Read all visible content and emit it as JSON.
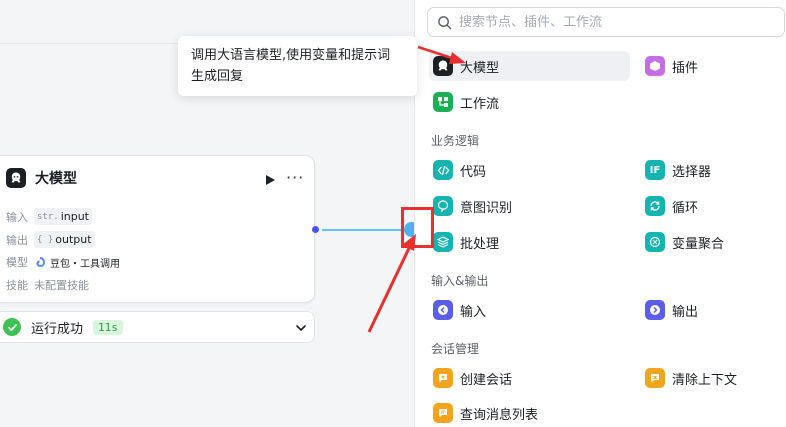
{
  "tooltip": {
    "line1": "调用大语言模型,使用变量和提示词",
    "line2": "生成回复"
  },
  "node": {
    "title": "大模型",
    "rows": {
      "input": {
        "label": "输入",
        "type": "str.",
        "value": "input"
      },
      "output": {
        "label": "输出",
        "type": "{ }",
        "value": "output"
      },
      "model": {
        "label": "模型",
        "value": "豆包・工具调用"
      },
      "skill": {
        "label": "技能",
        "value": "未配置技能"
      }
    }
  },
  "run_status": {
    "text": "运行成功",
    "time": "11s"
  },
  "panel": {
    "search_placeholder": "搜索节点、插件、工作流",
    "top_items": [
      {
        "label": "大模型",
        "icon": "llm-icon",
        "color": "#1c1f23"
      },
      {
        "label": "插件",
        "icon": "plugin-icon",
        "color": "#c46ee8"
      },
      {
        "label": "工作流",
        "icon": "workflow-icon",
        "color": "#1aae55"
      }
    ],
    "sections": [
      {
        "title": "业务逻辑",
        "items": [
          {
            "label": "代码",
            "icon": "code-icon",
            "color": "#14b5b0"
          },
          {
            "label": "选择器",
            "icon": "if-icon",
            "color": "#14b5b0"
          },
          {
            "label": "意图识别",
            "icon": "intent-icon",
            "color": "#14b5b0"
          },
          {
            "label": "循环",
            "icon": "loop-icon",
            "color": "#14b5b0"
          },
          {
            "label": "批处理",
            "icon": "batch-icon",
            "color": "#14b5b0"
          },
          {
            "label": "变量聚合",
            "icon": "variable-merge-icon",
            "color": "#14b5b0"
          }
        ]
      },
      {
        "title": "输入&输出",
        "items": [
          {
            "label": "输入",
            "icon": "input-icon",
            "color": "#5a5ee8"
          },
          {
            "label": "输出",
            "icon": "output-icon",
            "color": "#5a5ee8"
          }
        ]
      },
      {
        "title": "会话管理",
        "items": [
          {
            "label": "创建会话",
            "icon": "create-conversation-icon",
            "color": "#f2a51c"
          },
          {
            "label": "清除上下文",
            "icon": "clear-context-icon",
            "color": "#f2a51c"
          },
          {
            "label": "查询消息列表",
            "icon": "query-messages-icon",
            "color": "#f2a51c"
          }
        ]
      }
    ]
  },
  "colors": {
    "accent": "#4d53e8",
    "annotation_red": "#e83030",
    "success": "#3ec254"
  }
}
